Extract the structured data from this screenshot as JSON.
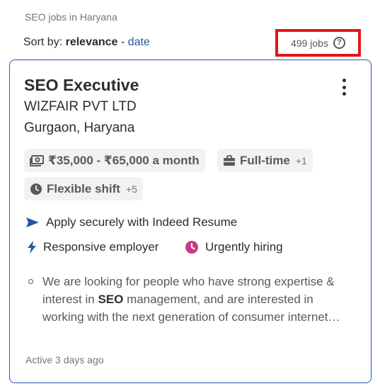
{
  "header": {
    "breadcrumb": "SEO jobs in Haryana",
    "sort_prefix": "Sort by:",
    "sort_active": "relevance",
    "sort_separator": "-",
    "sort_alt": "date",
    "job_count": "499 jobs",
    "help_symbol": "?"
  },
  "job": {
    "title": "SEO Executive",
    "company": "WIZFAIR PVT LTD",
    "location": "Gurgaon, Haryana",
    "salary": "₹35,000 - ₹65,000 a month",
    "job_type": "Full-time",
    "job_type_extra": "+1",
    "shift": "Flexible shift",
    "shift_extra": "+5",
    "apply_text": "Apply securely with Indeed Resume",
    "responsive_text": "Responsive employer",
    "urgent_text": "Urgently hiring",
    "snippet_before": "We are looking for people who have strong expertise & interest in ",
    "snippet_bold": "SEO",
    "snippet_after": " management, and are interested in working with the next generation of consumer internet…",
    "active": "Active 3 days ago"
  },
  "icons": {
    "salary": "money-icon",
    "job_type": "briefcase-icon",
    "shift": "clock-icon",
    "apply": "send-arrow-icon",
    "responsive": "lightning-icon",
    "urgent": "urgent-clock-icon",
    "help": "question-circle-icon",
    "menu": "kebab-menu-icon"
  },
  "colors": {
    "link": "#2557a7",
    "highlight_border": "#e4141b",
    "urgent": "#c73a88",
    "chip_bg": "#f3f2f1"
  }
}
